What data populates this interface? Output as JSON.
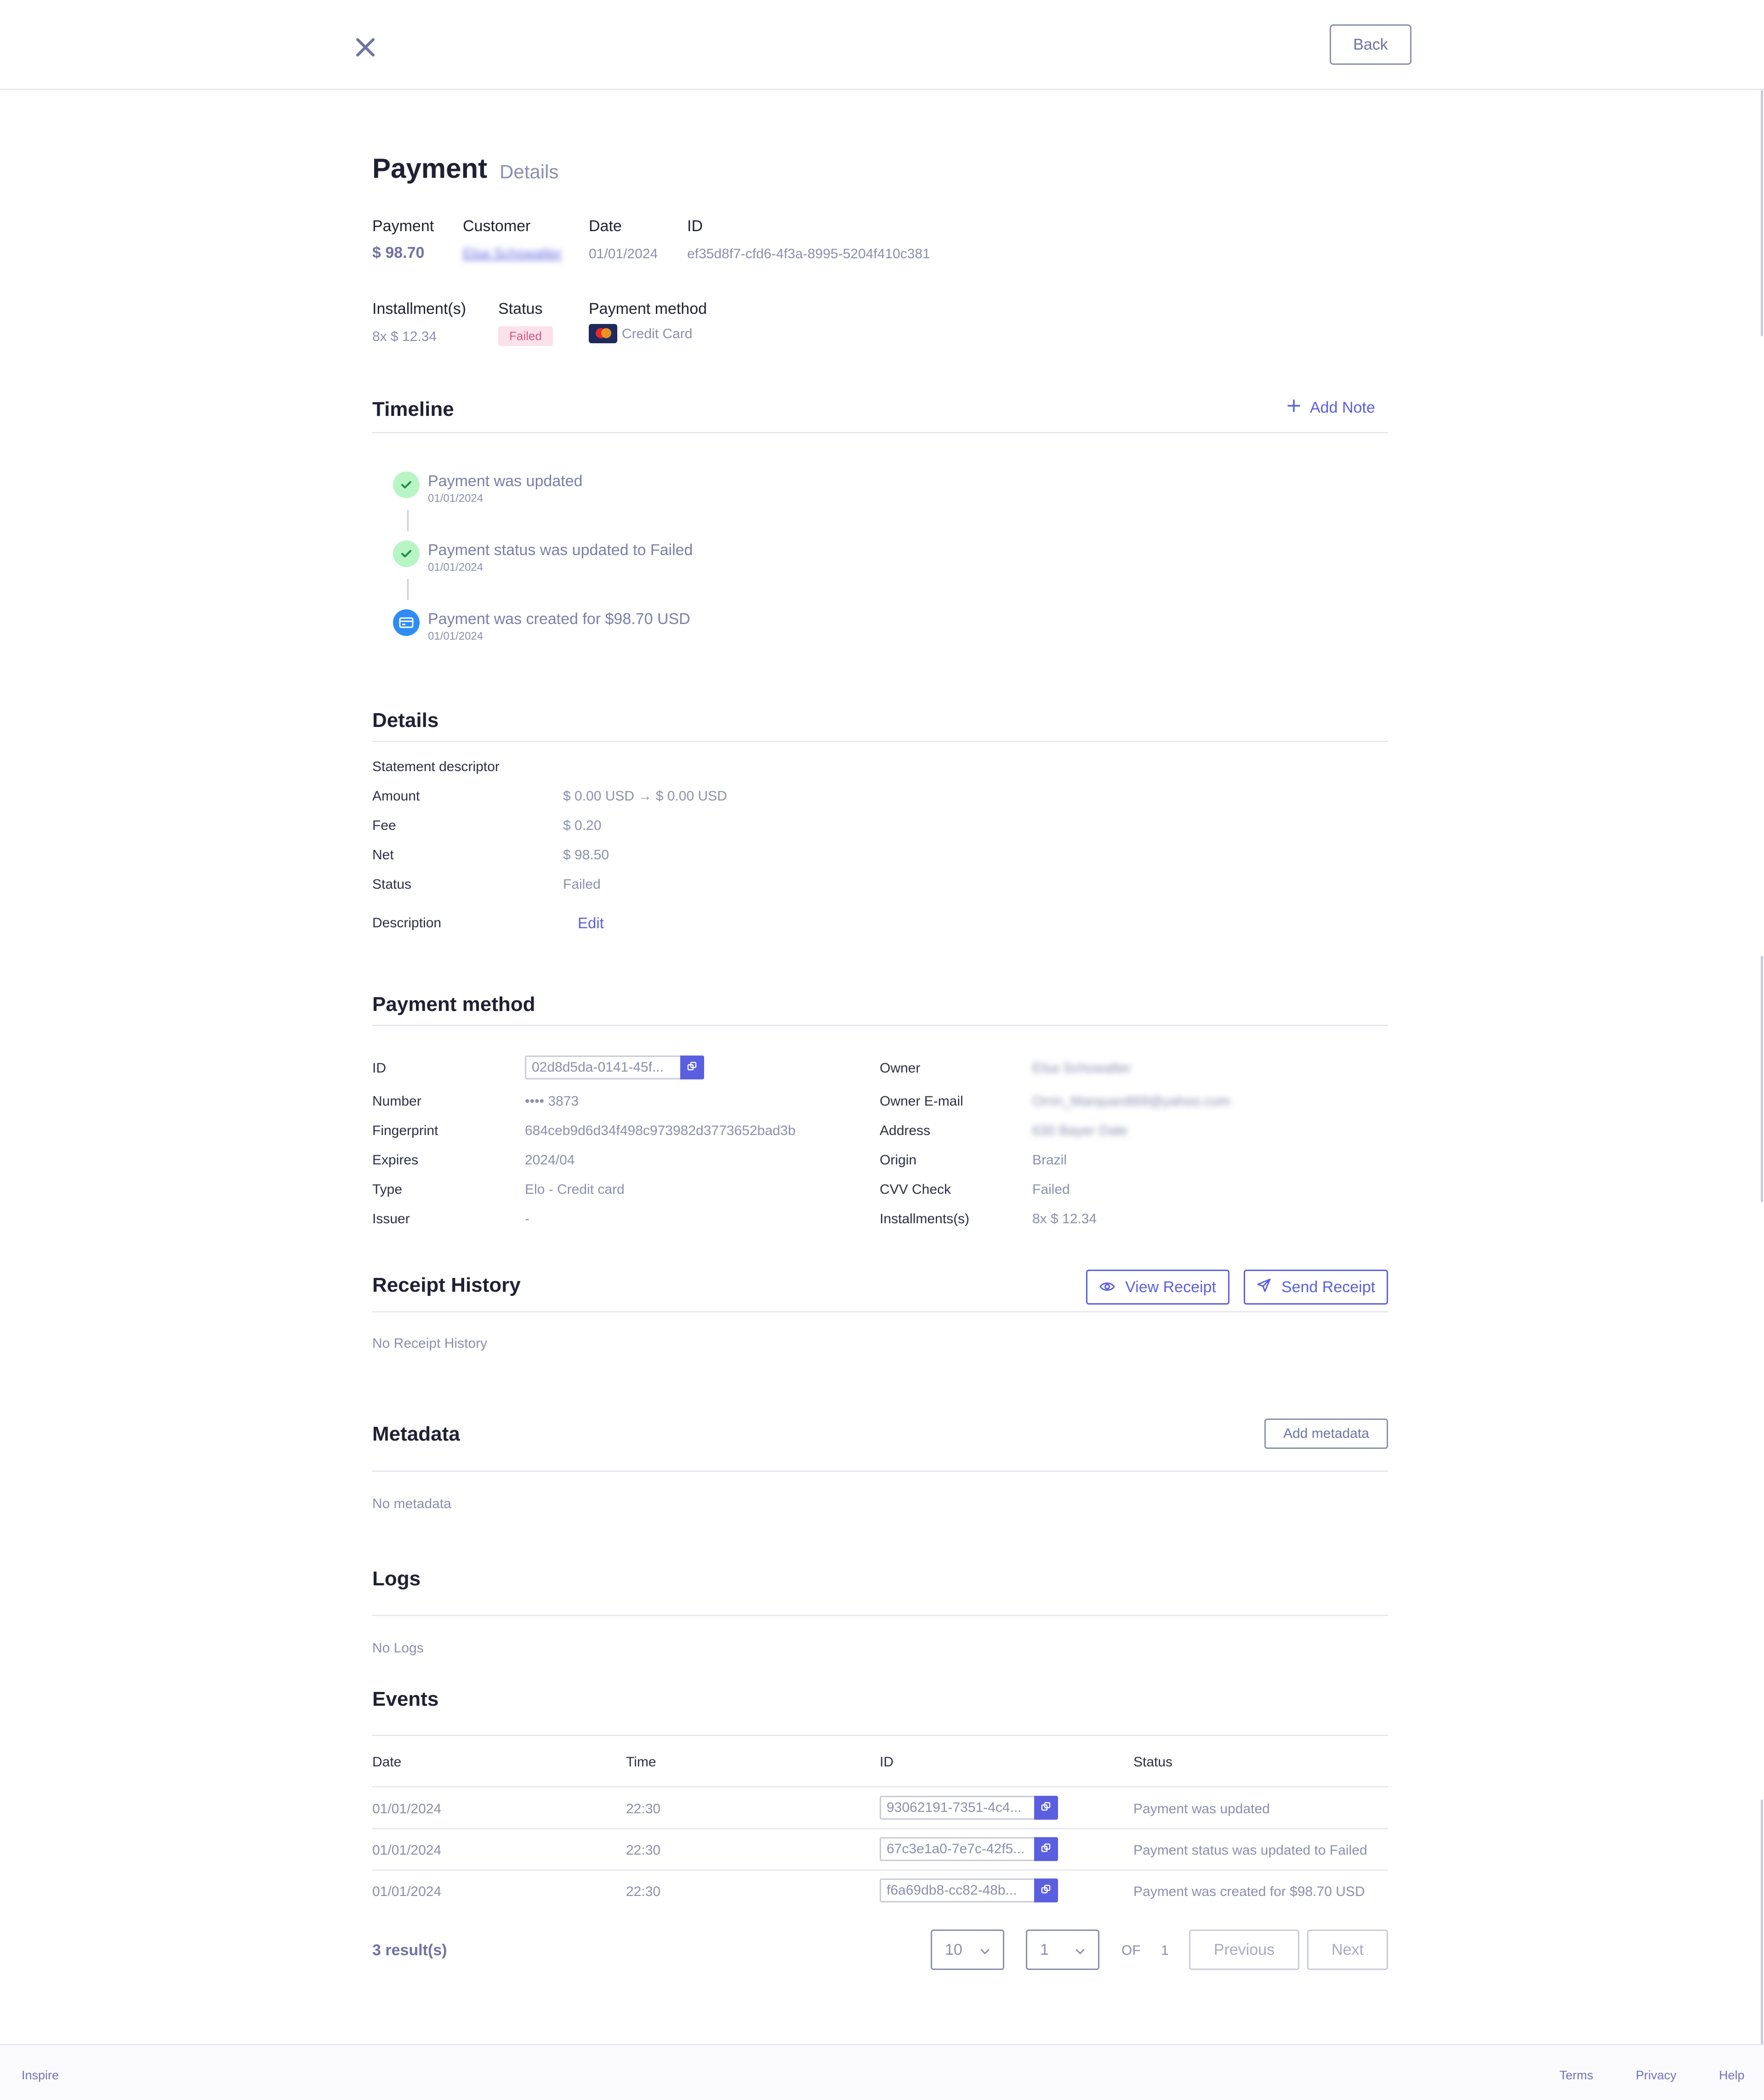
{
  "header": {
    "back_label": "Back"
  },
  "page": {
    "title": "Payment",
    "subtitle": "Details"
  },
  "summary": {
    "payment_label": "Payment",
    "payment_value": "$ 98.70",
    "customer_label": "Customer",
    "customer_value": "Elsa Schowalter",
    "date_label": "Date",
    "date_value": "01/01/2024",
    "id_label": "ID",
    "id_value": "ef35d8f7-cfd6-4f3a-8995-5204f410c381",
    "installments_label": "Installment(s)",
    "installments_value": "8x $ 12.34",
    "status_label": "Status",
    "status_value": "Failed",
    "method_label": "Payment method",
    "method_value": "Credit Card"
  },
  "timeline": {
    "title": "Timeline",
    "add_note_label": "Add Note",
    "items": [
      {
        "title": "Payment was updated",
        "date": "01/01/2024",
        "icon": "check-icon"
      },
      {
        "title": "Payment status was updated to Failed",
        "date": "01/01/2024",
        "icon": "check-icon"
      },
      {
        "title": "Payment was created for $98.70 USD",
        "date": "01/01/2024",
        "icon": "credit-card-icon"
      }
    ]
  },
  "details": {
    "title": "Details",
    "statement_label": "Statement descriptor",
    "amount_label": "Amount",
    "amount_value": "$ 0.00 USD → $ 0.00 USD",
    "fee_label": "Fee",
    "fee_value": "$ 0.20",
    "net_label": "Net",
    "net_value": "$ 98.50",
    "status_label": "Status",
    "status_value": "Failed",
    "description_label": "Description",
    "edit_label": "Edit"
  },
  "payment_method": {
    "title": "Payment method",
    "id_label": "ID",
    "id_value": "02d8d5da-0141-45f...",
    "number_label": "Number",
    "number_value": "•••• 3873",
    "fingerprint_label": "Fingerprint",
    "fingerprint_value": "684ceb9d6d34f498c973982d3773652bad3b",
    "expires_label": "Expires",
    "expires_value": "2024/04",
    "type_label": "Type",
    "type_value": "Elo - Credit card",
    "issuer_label": "Issuer",
    "issuer_value": "-",
    "owner_label": "Owner",
    "owner_value": "Elsa Schowalter",
    "email_label": "Owner E-mail",
    "email_value": "Orrin_Marquardt69@yahoo.com",
    "address_label": "Address",
    "address_value": "630 Bayer Dale",
    "origin_label": "Origin",
    "origin_value": "Brazil",
    "cvv_label": "CVV Check",
    "cvv_value": "Failed",
    "installments_label": "Installments(s)",
    "installments_value": "8x $ 12.34"
  },
  "receipt": {
    "title": "Receipt History",
    "view_label": "View Receipt",
    "send_label": "Send Receipt",
    "empty": "No Receipt History"
  },
  "metadata": {
    "title": "Metadata",
    "add_label": "Add metadata",
    "empty": "No metadata"
  },
  "logs": {
    "title": "Logs",
    "empty": "No Logs"
  },
  "events": {
    "title": "Events",
    "columns": [
      "Date",
      "Time",
      "ID",
      "Status"
    ],
    "rows": [
      {
        "date": "01/01/2024",
        "time": "22:30",
        "id": "93062191-7351-4c4...",
        "status": "Payment was updated"
      },
      {
        "date": "01/01/2024",
        "time": "22:30",
        "id": "67c3e1a0-7e7c-42f5...",
        "status": "Payment status was updated to Failed"
      },
      {
        "date": "01/01/2024",
        "time": "22:30",
        "id": "f6a69db8-cc82-48b...",
        "status": "Payment was created for $98.70 USD"
      }
    ],
    "results": "3 result(s)",
    "page_size": "10",
    "page": "1",
    "of_label": "OF",
    "total_pages": "1",
    "previous_label": "Previous",
    "next_label": "Next"
  },
  "footer": {
    "brand": "Inspire",
    "terms": "Terms",
    "privacy": "Privacy",
    "help": "Help"
  },
  "colors": {
    "accent": "#5a5fe0",
    "failed_bg": "#fbe1ea",
    "failed_text": "#d6577e",
    "success": "#b7f5c5",
    "info": "#2f8cf5"
  }
}
